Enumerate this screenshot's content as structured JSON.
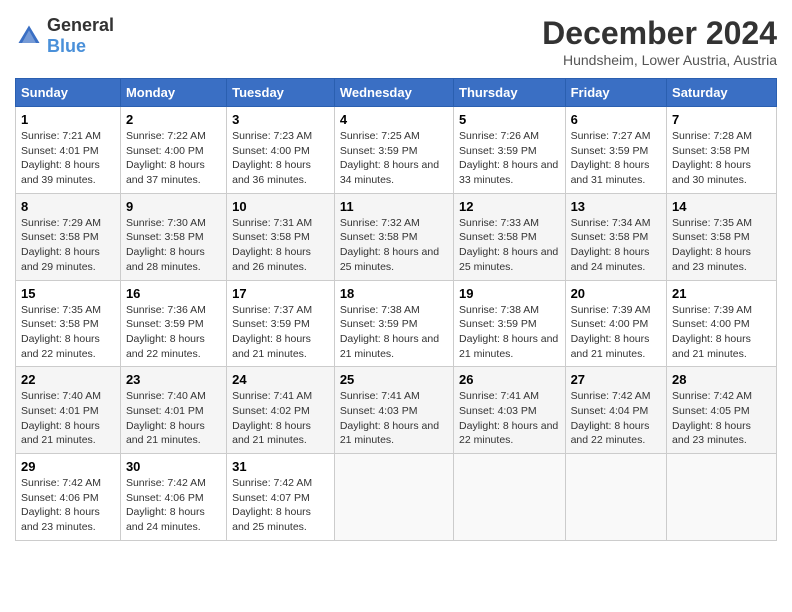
{
  "logo": {
    "general": "General",
    "blue": "Blue"
  },
  "title": "December 2024",
  "location": "Hundsheim, Lower Austria, Austria",
  "headers": [
    "Sunday",
    "Monday",
    "Tuesday",
    "Wednesday",
    "Thursday",
    "Friday",
    "Saturday"
  ],
  "weeks": [
    [
      {
        "day": "1",
        "sunrise": "Sunrise: 7:21 AM",
        "sunset": "Sunset: 4:01 PM",
        "daylight": "Daylight: 8 hours and 39 minutes."
      },
      {
        "day": "2",
        "sunrise": "Sunrise: 7:22 AM",
        "sunset": "Sunset: 4:00 PM",
        "daylight": "Daylight: 8 hours and 37 minutes."
      },
      {
        "day": "3",
        "sunrise": "Sunrise: 7:23 AM",
        "sunset": "Sunset: 4:00 PM",
        "daylight": "Daylight: 8 hours and 36 minutes."
      },
      {
        "day": "4",
        "sunrise": "Sunrise: 7:25 AM",
        "sunset": "Sunset: 3:59 PM",
        "daylight": "Daylight: 8 hours and 34 minutes."
      },
      {
        "day": "5",
        "sunrise": "Sunrise: 7:26 AM",
        "sunset": "Sunset: 3:59 PM",
        "daylight": "Daylight: 8 hours and 33 minutes."
      },
      {
        "day": "6",
        "sunrise": "Sunrise: 7:27 AM",
        "sunset": "Sunset: 3:59 PM",
        "daylight": "Daylight: 8 hours and 31 minutes."
      },
      {
        "day": "7",
        "sunrise": "Sunrise: 7:28 AM",
        "sunset": "Sunset: 3:58 PM",
        "daylight": "Daylight: 8 hours and 30 minutes."
      }
    ],
    [
      {
        "day": "8",
        "sunrise": "Sunrise: 7:29 AM",
        "sunset": "Sunset: 3:58 PM",
        "daylight": "Daylight: 8 hours and 29 minutes."
      },
      {
        "day": "9",
        "sunrise": "Sunrise: 7:30 AM",
        "sunset": "Sunset: 3:58 PM",
        "daylight": "Daylight: 8 hours and 28 minutes."
      },
      {
        "day": "10",
        "sunrise": "Sunrise: 7:31 AM",
        "sunset": "Sunset: 3:58 PM",
        "daylight": "Daylight: 8 hours and 26 minutes."
      },
      {
        "day": "11",
        "sunrise": "Sunrise: 7:32 AM",
        "sunset": "Sunset: 3:58 PM",
        "daylight": "Daylight: 8 hours and 25 minutes."
      },
      {
        "day": "12",
        "sunrise": "Sunrise: 7:33 AM",
        "sunset": "Sunset: 3:58 PM",
        "daylight": "Daylight: 8 hours and 25 minutes."
      },
      {
        "day": "13",
        "sunrise": "Sunrise: 7:34 AM",
        "sunset": "Sunset: 3:58 PM",
        "daylight": "Daylight: 8 hours and 24 minutes."
      },
      {
        "day": "14",
        "sunrise": "Sunrise: 7:35 AM",
        "sunset": "Sunset: 3:58 PM",
        "daylight": "Daylight: 8 hours and 23 minutes."
      }
    ],
    [
      {
        "day": "15",
        "sunrise": "Sunrise: 7:35 AM",
        "sunset": "Sunset: 3:58 PM",
        "daylight": "Daylight: 8 hours and 22 minutes."
      },
      {
        "day": "16",
        "sunrise": "Sunrise: 7:36 AM",
        "sunset": "Sunset: 3:59 PM",
        "daylight": "Daylight: 8 hours and 22 minutes."
      },
      {
        "day": "17",
        "sunrise": "Sunrise: 7:37 AM",
        "sunset": "Sunset: 3:59 PM",
        "daylight": "Daylight: 8 hours and 21 minutes."
      },
      {
        "day": "18",
        "sunrise": "Sunrise: 7:38 AM",
        "sunset": "Sunset: 3:59 PM",
        "daylight": "Daylight: 8 hours and 21 minutes."
      },
      {
        "day": "19",
        "sunrise": "Sunrise: 7:38 AM",
        "sunset": "Sunset: 3:59 PM",
        "daylight": "Daylight: 8 hours and 21 minutes."
      },
      {
        "day": "20",
        "sunrise": "Sunrise: 7:39 AM",
        "sunset": "Sunset: 4:00 PM",
        "daylight": "Daylight: 8 hours and 21 minutes."
      },
      {
        "day": "21",
        "sunrise": "Sunrise: 7:39 AM",
        "sunset": "Sunset: 4:00 PM",
        "daylight": "Daylight: 8 hours and 21 minutes."
      }
    ],
    [
      {
        "day": "22",
        "sunrise": "Sunrise: 7:40 AM",
        "sunset": "Sunset: 4:01 PM",
        "daylight": "Daylight: 8 hours and 21 minutes."
      },
      {
        "day": "23",
        "sunrise": "Sunrise: 7:40 AM",
        "sunset": "Sunset: 4:01 PM",
        "daylight": "Daylight: 8 hours and 21 minutes."
      },
      {
        "day": "24",
        "sunrise": "Sunrise: 7:41 AM",
        "sunset": "Sunset: 4:02 PM",
        "daylight": "Daylight: 8 hours and 21 minutes."
      },
      {
        "day": "25",
        "sunrise": "Sunrise: 7:41 AM",
        "sunset": "Sunset: 4:03 PM",
        "daylight": "Daylight: 8 hours and 21 minutes."
      },
      {
        "day": "26",
        "sunrise": "Sunrise: 7:41 AM",
        "sunset": "Sunset: 4:03 PM",
        "daylight": "Daylight: 8 hours and 22 minutes."
      },
      {
        "day": "27",
        "sunrise": "Sunrise: 7:42 AM",
        "sunset": "Sunset: 4:04 PM",
        "daylight": "Daylight: 8 hours and 22 minutes."
      },
      {
        "day": "28",
        "sunrise": "Sunrise: 7:42 AM",
        "sunset": "Sunset: 4:05 PM",
        "daylight": "Daylight: 8 hours and 23 minutes."
      }
    ],
    [
      {
        "day": "29",
        "sunrise": "Sunrise: 7:42 AM",
        "sunset": "Sunset: 4:06 PM",
        "daylight": "Daylight: 8 hours and 23 minutes."
      },
      {
        "day": "30",
        "sunrise": "Sunrise: 7:42 AM",
        "sunset": "Sunset: 4:06 PM",
        "daylight": "Daylight: 8 hours and 24 minutes."
      },
      {
        "day": "31",
        "sunrise": "Sunrise: 7:42 AM",
        "sunset": "Sunset: 4:07 PM",
        "daylight": "Daylight: 8 hours and 25 minutes."
      },
      null,
      null,
      null,
      null
    ]
  ]
}
